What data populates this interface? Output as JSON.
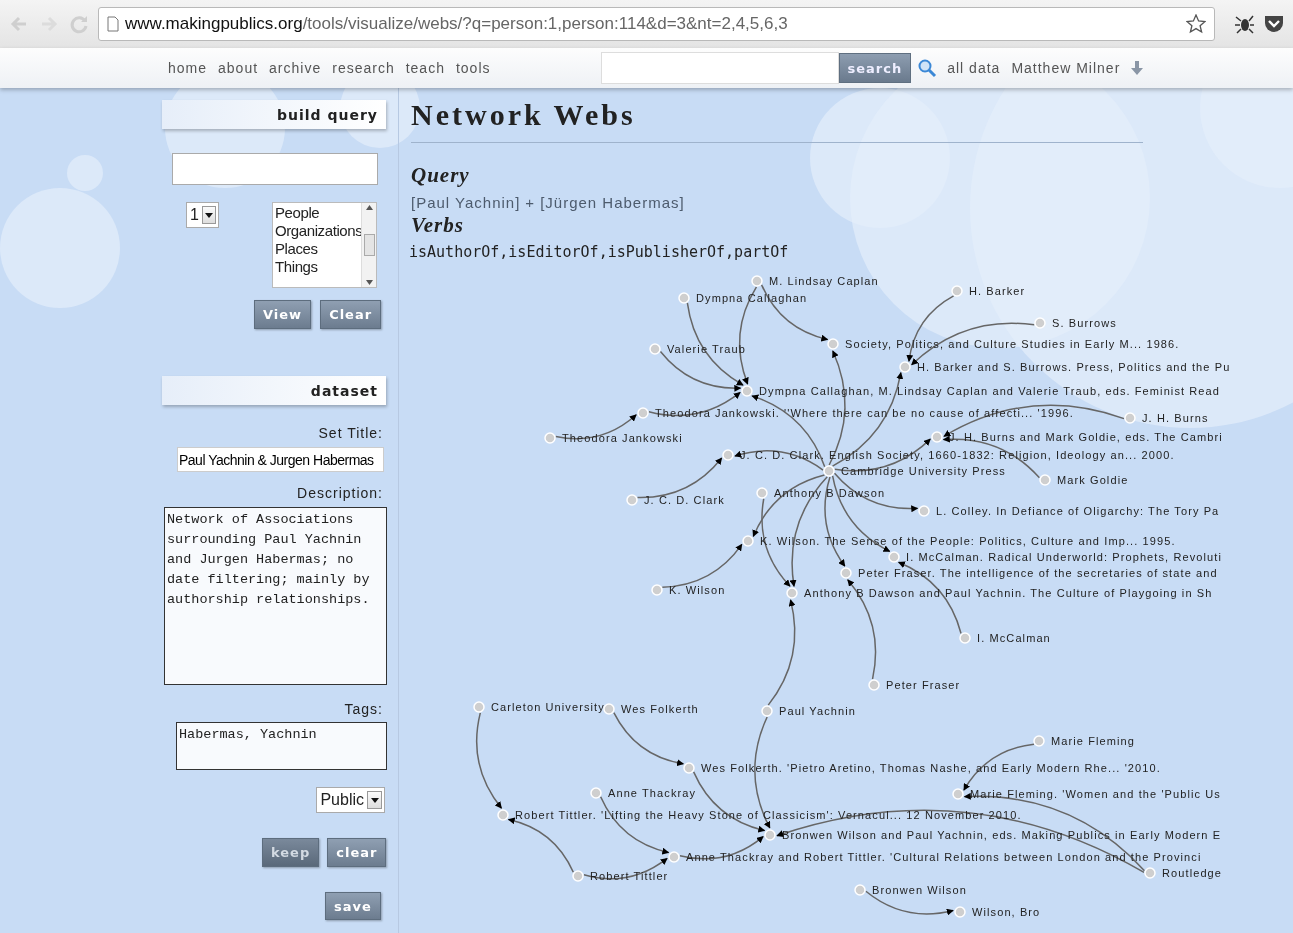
{
  "browser": {
    "url_domain": "www.makingpublics.org",
    "url_path": "/tools/visualize/webs/?q=person:1,person:114&d=3&nt=2,4,5,6,3"
  },
  "nav": {
    "links": [
      "home",
      "about",
      "archive",
      "research",
      "teach",
      "tools"
    ],
    "search_button": "search",
    "all_data": "all data",
    "user": "Matthew Milner"
  },
  "build_query": {
    "title": "build query",
    "depth": "1",
    "types": [
      "People",
      "Organizations",
      "Places",
      "Things"
    ],
    "buttons": [
      {
        "label": "View",
        "disabled": false
      },
      {
        "label": "Clear",
        "disabled": false
      }
    ]
  },
  "dataset": {
    "title": "dataset",
    "set_title_label": "Set Title:",
    "set_title": "Paul Yachnin & Jurgen Habermas",
    "description_label": "Description:",
    "description": "Network of Associations surrounding Paul Yachnin and Jurgen Habermas; no date filtering; mainly by authorship relationships.",
    "tags_label": "Tags:",
    "tags": "Habermas, Yachnin",
    "visibility": "Public",
    "buttons": [
      {
        "label": "keep",
        "disabled": true
      },
      {
        "label": "clear",
        "disabled": false
      }
    ],
    "save": "save"
  },
  "main": {
    "title": "Network Webs",
    "query_heading": "Query",
    "query_people": [
      "[Paul Yachnin]",
      "[Jürgen Habermas]"
    ],
    "query_join": "+",
    "verbs_heading": "Verbs",
    "verbs": "isAuthorOf,isEditorOf,isPublisherOf,partOf"
  },
  "graph": {
    "nodes": [
      {
        "label": "M. Lindsay Caplan"
      },
      {
        "label": "H. Barker"
      },
      {
        "label": "Dympna Callaghan"
      },
      {
        "label": "S. Burrows"
      },
      {
        "label": "Valerie Traub"
      },
      {
        "label": "Society, Politics, and Culture Studies in Early M... 1986."
      },
      {
        "label": "H. Barker and S. Burrows. Press, Politics and the Pu"
      },
      {
        "label": "Dympna Callaghan, M. Lindsay Caplan and Valerie Traub, eds. Feminist Read"
      },
      {
        "label": "Theodora Jankowski. ''Where there can be no cause of affecti... '1996."
      },
      {
        "label": "J. H. Burns"
      },
      {
        "label": "Theodora Jankowski"
      },
      {
        "label": "J. H. Burns and Mark Goldie, eds. The Cambri"
      },
      {
        "label": "J. C. D. Clark. English Society, 1660-1832: Religion, Ideology an... 2000."
      },
      {
        "label": "Cambridge University Press"
      },
      {
        "label": "Mark Goldie"
      },
      {
        "label": "Anthony B Dawson"
      },
      {
        "label": "J. C. D. Clark"
      },
      {
        "label": "L. Colley. In Defiance of Oligarchy: The Tory Pa"
      },
      {
        "label": "K. Wilson. The Sense of the People: Politics, Culture and Imp... 1995."
      },
      {
        "label": "I. McCalman. Radical Underworld: Prophets, Revoluti"
      },
      {
        "label": "Peter Fraser. The intelligence of the secretaries of state and"
      },
      {
        "label": "K. Wilson"
      },
      {
        "label": "Anthony B Dawson and Paul Yachnin. The Culture of Playgoing in Sh"
      },
      {
        "label": "I. McCalman"
      },
      {
        "label": "Peter Fraser"
      },
      {
        "label": "Carleton University"
      },
      {
        "label": "Wes Folkerth"
      },
      {
        "label": "Paul Yachnin"
      },
      {
        "label": "Marie Fleming"
      },
      {
        "label": "Wes Folkerth. 'Pietro Aretino, Thomas Nashe, and Early Modern Rhe... '2010."
      },
      {
        "label": "Anne Thackray"
      },
      {
        "label": "Marie Fleming. 'Women and the 'Public Us"
      },
      {
        "label": "Robert Tittler. 'Lifting the Heavy Stone of Classicism': Vernacul... 12 November 2010."
      },
      {
        "label": "Bronwen Wilson and Paul Yachnin, eds. Making Publics in Early Modern E"
      },
      {
        "label": "Anne Thackray and Robert Tittler. 'Cultural Relations between London and the Provinci"
      },
      {
        "label": "Routledge"
      },
      {
        "label": "Robert Tittler"
      },
      {
        "label": "Bronwen Wilson"
      },
      {
        "label": "Wilson, Bro"
      }
    ]
  }
}
